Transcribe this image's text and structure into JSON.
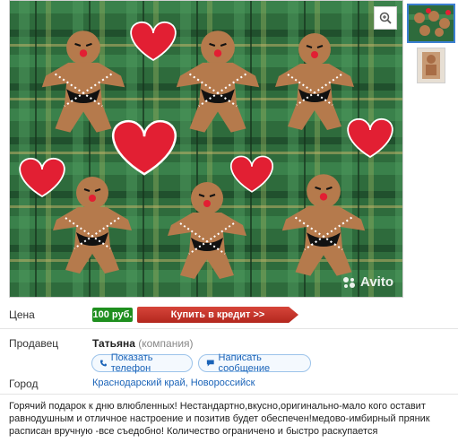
{
  "gallery": {
    "watermark_text": "Avito",
    "zoom_icon": "magnifier-plus-icon",
    "colors": {
      "plaid_green": "#2e6b3c",
      "cookie": "#b57a4c",
      "heart": "#e21f33"
    }
  },
  "price": {
    "label": "Цена",
    "value": "100 руб.",
    "credit_button": "Купить в кредит >>"
  },
  "seller": {
    "label": "Продавец",
    "name": "Татьяна",
    "type": "(компания)",
    "show_phone": "Показать телефон",
    "write_message": "Написать сообщение",
    "phone_icon": "phone-icon",
    "message_icon": "chat-icon"
  },
  "city": {
    "label": "Город",
    "value": "Краснодарский край, Новороссийск"
  },
  "description": "Горячий подарок к дню влюбленных! Нестандартно,вкусно,оригинально-мало кого оставит равнодушным и отличное настроение и позитив будет обеспечен!медово-имбирный пряник расписан вручную -все съедобно! Количество ограничено и быстро раскупается"
}
